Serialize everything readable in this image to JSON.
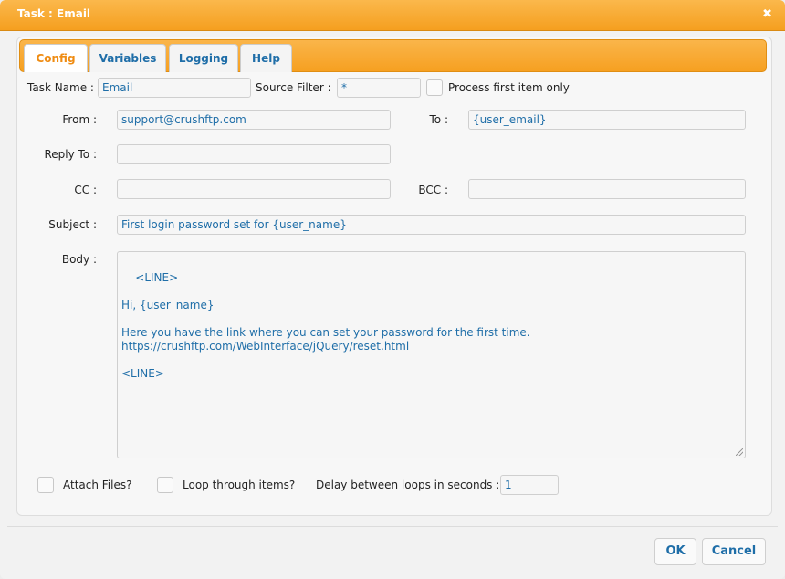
{
  "window": {
    "title": "Task : Email",
    "close_symbol": "✖"
  },
  "tabs": [
    {
      "label": "Config",
      "active": true
    },
    {
      "label": "Variables",
      "active": false
    },
    {
      "label": "Logging",
      "active": false
    },
    {
      "label": "Help",
      "active": false
    }
  ],
  "config": {
    "task_name_label": "Task Name :",
    "task_name_value": "Email",
    "source_filter_label": "Source Filter :",
    "source_filter_value": "*",
    "process_first_label": "Process first item only",
    "from_label": "From :",
    "from_value": "support@crushftp.com",
    "to_label": "To :",
    "to_value": "{user_email}",
    "reply_to_label": "Reply To :",
    "reply_to_value": "",
    "cc_label": "CC :",
    "cc_value": "",
    "bcc_label": "BCC :",
    "bcc_value": "",
    "subject_label": "Subject :",
    "subject_value": "First login password set for {user_name}",
    "body_label": "Body :",
    "body_value": "<LINE>\n\nHi, {user_name}\n\nHere you have the link where you can set your password for the first time.\nhttps://crushftp.com/WebInterface/jQuery/reset.html\n\n<LINE>",
    "attach_files_label": "Attach Files?",
    "loop_label": "Loop through items?",
    "delay_label": "Delay between loops in seconds :",
    "delay_value": "1"
  },
  "buttons": {
    "ok": "OK",
    "cancel": "Cancel"
  },
  "colors": {
    "accent": "#f6a021",
    "link_text": "#1f6ea8",
    "active_tab_text": "#ef8c13"
  }
}
